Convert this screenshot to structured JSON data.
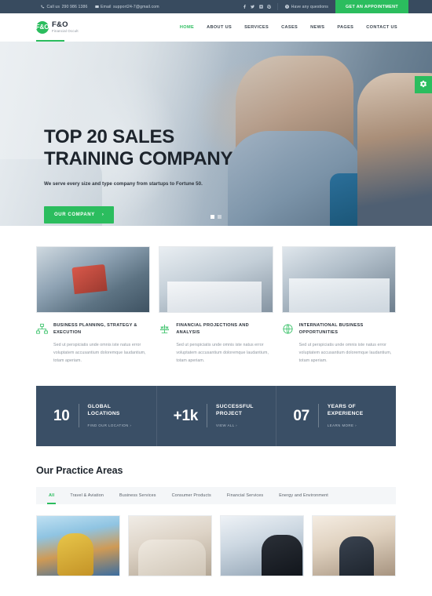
{
  "topbar": {
    "phone_label": "Call us",
    "phone": "290 986 1386",
    "email_label": "Email",
    "email": "support24-7@gmail.com",
    "socials": [
      "facebook-icon",
      "twitter-icon",
      "instagram-icon",
      "pinterest-icon"
    ],
    "questions": "Have any questions",
    "appointment_button": "GET AN APPOINTMENT"
  },
  "header": {
    "logo_mark": "F&O",
    "logo_name": "F&O",
    "logo_sub": "Financial Occult",
    "nav": [
      {
        "label": "HOME",
        "active": true
      },
      {
        "label": "ABOUT US",
        "active": false
      },
      {
        "label": "SERVICES",
        "active": false
      },
      {
        "label": "CASES",
        "active": false
      },
      {
        "label": "NEWS",
        "active": false
      },
      {
        "label": "PAGES",
        "active": false
      },
      {
        "label": "CONTACT US",
        "active": false
      }
    ]
  },
  "hero": {
    "title_line1": "TOP 20 SALES",
    "title_line2": "TRAINING COMPANY",
    "subtitle": "We serve every size and type company from startups to Fortune 50.",
    "button": "OUR COMPANY",
    "button_arrow": "›",
    "slides_total": 2,
    "slide_active": 1,
    "settings_icon": "gear-icon"
  },
  "services": [
    {
      "icon": "sitemap-icon",
      "title": "BUSINESS PLANNING, STRATEGY & EXECUTION",
      "body": "Sed ut perspiciatis unde omnis iste natus error voluptatem accusantium doloremque laudantium, totam aperiam."
    },
    {
      "icon": "scales-icon",
      "title": "FINANCIAL PROJECTIONS AND ANALYSIS",
      "body": "Sed ut perspiciatis unde omnis iste natus error voluptatem accusantium doloremque laudantium, totam aperiam."
    },
    {
      "icon": "globe-icon",
      "title": "INTERNATIONAL BUSINESS OPPORTUNITIES",
      "body": "Sed ut perspiciatis unde omnis iste natus error voluptatem accusantium doloremque laudantium, totam aperiam."
    }
  ],
  "stats": [
    {
      "number": "10",
      "label_line1": "GLOBAL",
      "label_line2": "LOCATIONS",
      "link": "FIND OUR LOCATION ›"
    },
    {
      "number": "+1k",
      "label_line1": "SUCCESSFUL",
      "label_line2": "PROJECT",
      "link": "VIEW ALL ›"
    },
    {
      "number": "07",
      "label_line1": "YEARS OF",
      "label_line2": "EXPERIENCE",
      "link": "LEARN MORE ›"
    }
  ],
  "practice": {
    "title": "Our Practice Areas",
    "filters": [
      {
        "label": "All",
        "active": true
      },
      {
        "label": "Travel & Aviation",
        "active": false
      },
      {
        "label": "Business Services",
        "active": false
      },
      {
        "label": "Consumer Products",
        "active": false
      },
      {
        "label": "Financial Services",
        "active": false
      },
      {
        "label": "Energy and Environment",
        "active": false
      }
    ],
    "gallery": [
      "construction-worker-photo",
      "two-men-meeting-photo",
      "businessman-and-woman-photo",
      "team-with-laptop-photo"
    ]
  },
  "colors": {
    "accent_green": "#2bbd5e",
    "dark_navy": "#384b5f",
    "stats_navy": "#3a4f66",
    "text_dark": "#1f262e",
    "muted": "#8d959e"
  }
}
